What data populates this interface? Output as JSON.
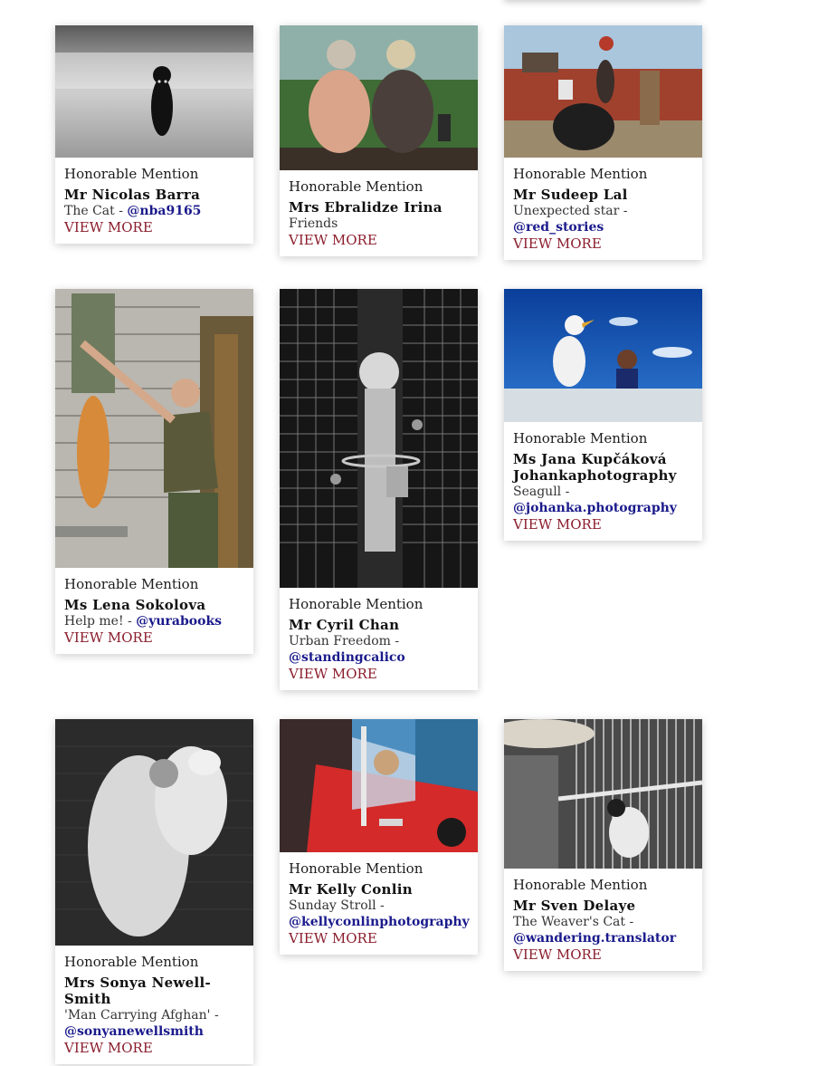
{
  "cards": [
    {
      "award": "Honorable Mention",
      "name": "Mr  Nicolas  Barra",
      "title": "The Cat  -",
      "handle": "@nba9165",
      "link": "VIEW MORE"
    },
    {
      "award": "Honorable Mention",
      "name": "Mrs  Ebralidze  Irina",
      "title": "Friends",
      "handle": "",
      "link": "VIEW MORE"
    },
    {
      "award": "Honorable Mention",
      "name": "Mr  Sudeep  Lal",
      "title": "Unexpected star  -",
      "handle": "@red_stories",
      "link": "VIEW MORE"
    },
    {
      "award": "Honorable Mention",
      "name": "Ms  Lena  Sokolova",
      "title": "Help me!  -",
      "handle": "@yurabooks",
      "link": "VIEW MORE"
    },
    {
      "award": "Honorable Mention",
      "name": "Mr  Cyril  Chan",
      "title": "Urban Freedom  -",
      "handle": "@standingcalico",
      "link": "VIEW MORE"
    },
    {
      "award": "Honorable Mention",
      "name": "Ms  Jana  Kupčáková  Johankaphotography",
      "title": "Seagull  -",
      "handle": "@johanka.photography",
      "link": "VIEW MORE"
    },
    {
      "award": "Honorable Mention",
      "name": "Mrs  Sonya  Newell-Smith",
      "title": "'Man Carrying Afghan'  -",
      "handle": "@sonyanewellsmith",
      "link": "VIEW MORE"
    },
    {
      "award": "Honorable Mention",
      "name": "Mr  Kelly  Conlin",
      "title": "Sunday Stroll  -",
      "handle": "@kellyconlinphotography",
      "link": "VIEW MORE"
    },
    {
      "award": "Honorable Mention",
      "name": "Mr  Sven  Delaye",
      "title": "The Weaver's Cat  -",
      "handle": "@wandering.translator",
      "link": "VIEW MORE"
    }
  ]
}
